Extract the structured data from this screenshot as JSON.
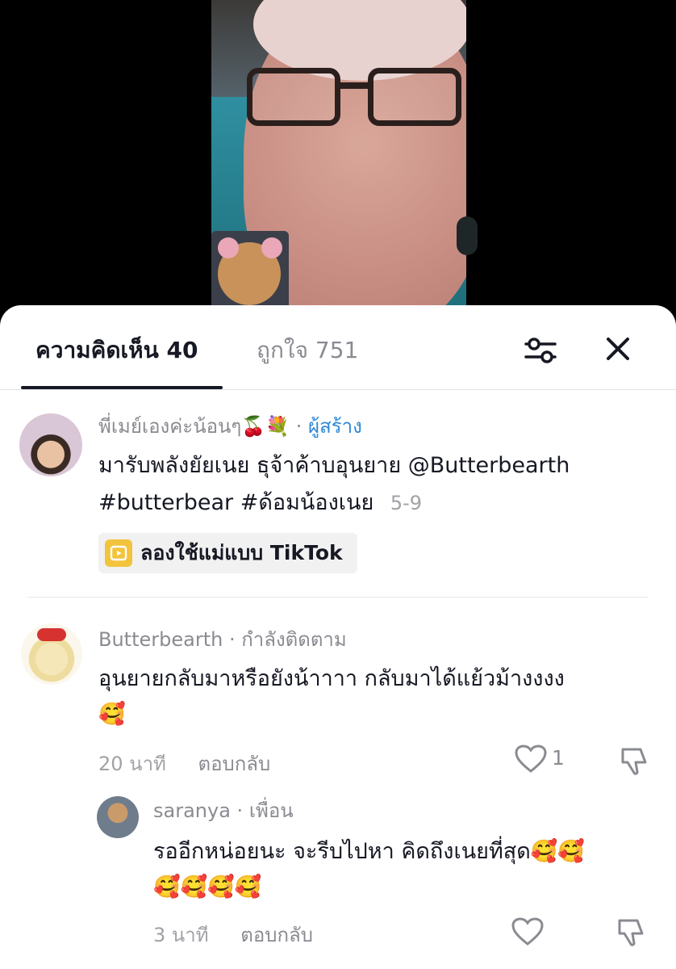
{
  "tabs": {
    "comments_label": "ความคิดเห็น 40",
    "likes_label": "ถูกใจ 751"
  },
  "icons": {
    "filter": "sliders-icon",
    "close": "close-icon",
    "heart": "heart-icon",
    "dislike": "dislike-icon",
    "template": "tiktok-template-icon"
  },
  "colors": {
    "creator_badge": "#2f88d8",
    "template_icon": "#f2c33c",
    "text_primary": "#161823",
    "text_secondary": "#8a8b91"
  },
  "creator_comment": {
    "author": "พี่เมย์เองค่ะน้อนๆ🍒💐",
    "separator": "·",
    "badge": "ผู้สร้าง",
    "line1": "มารับพลังยัยเนย ธุจ้าค้าบอุนยาย @Butterbearth",
    "line2": "#butterbear #ด้อมน้องเนย",
    "date": "5-9",
    "template_button": "ลองใช้แม่แบบ TikTok"
  },
  "comments": [
    {
      "author": "Butterbearth",
      "relation": "กำลังติดตาม",
      "text_line1": "อุนยายกลับมาหรือยังน้าาาา กลับมาได้แย้วม้างงงง",
      "text_line2": "🥰",
      "time": "20 นาที",
      "reply_label": "ตอบกลับ",
      "likes": "1"
    },
    {
      "author": "saranya",
      "relation": "เพื่อน",
      "text_line1": "รออีกหน่อยนะ จะรีบไปหา คิดถึงเนยที่สุด🥰🥰",
      "text_line2": "🥰🥰🥰🥰",
      "time": "3 นาที",
      "reply_label": "ตอบกลับ"
    }
  ]
}
